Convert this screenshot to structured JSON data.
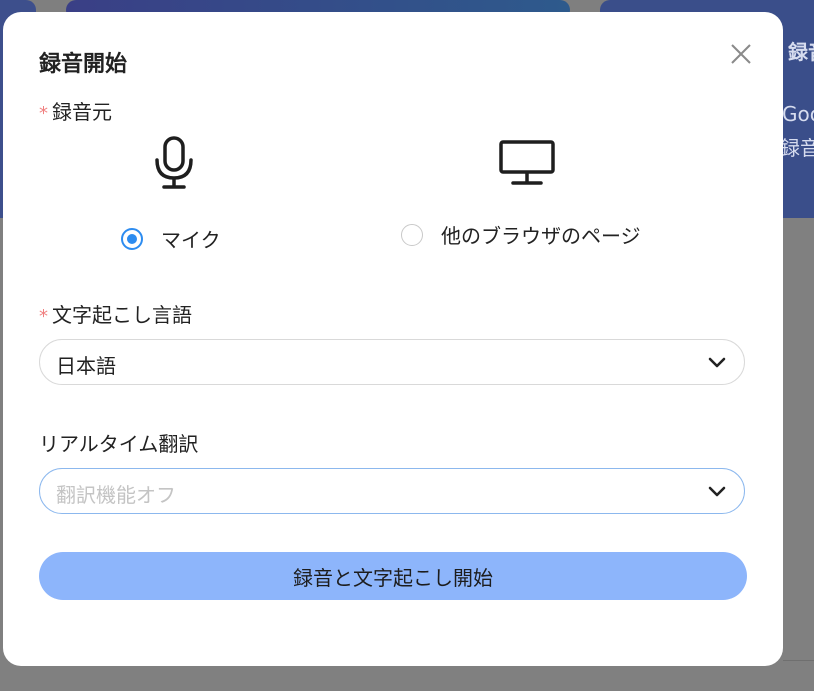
{
  "background": {
    "text_1": "録音",
    "text_2": "Goo",
    "text_3": "録音"
  },
  "dialog": {
    "title": "録音開始",
    "close_icon": "close-icon",
    "source": {
      "required_mark": "*",
      "label": "録音元",
      "options": [
        {
          "icon": "microphone-icon",
          "label": "マイク",
          "selected": true
        },
        {
          "icon": "monitor-icon",
          "label": "他のブラウザのページ",
          "selected": false
        }
      ]
    },
    "language": {
      "required_mark": "*",
      "label": "文字起こし言語",
      "value": "日本語"
    },
    "realtime_translation": {
      "label": "リアルタイム翻訳",
      "placeholder": "翻訳機能オフ"
    },
    "start_button": "録音と文字起こし開始",
    "colors": {
      "accent": "#2d8cf0",
      "button_bg": "#8db5fb",
      "required": "#f08080"
    }
  }
}
